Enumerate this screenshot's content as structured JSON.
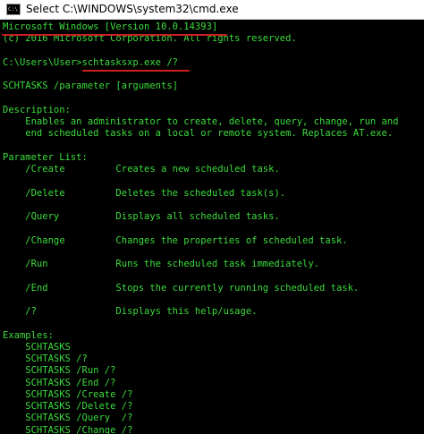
{
  "window": {
    "title": "Select C:\\WINDOWS\\system32\\cmd.exe",
    "icon": "cmd-icon",
    "icon_glyph": "C:\\"
  },
  "colors": {
    "text": "#3cdc3c",
    "background": "#000000",
    "annotation": "#cc1f1f"
  },
  "console": {
    "lines": [
      "Microsoft Windows [Version 10.0.14393]",
      "(c) 2016 Microsoft Corporation. All rights reserved.",
      "",
      "C:\\Users\\User>schtasksxp.exe /?",
      "",
      "SCHTASKS /parameter [arguments]",
      "",
      "Description:",
      "    Enables an administrator to create, delete, query, change, run and",
      "    end scheduled tasks on a local or remote system. Replaces AT.exe.",
      "",
      "Parameter List:",
      "    /Create         Creates a new scheduled task.",
      "",
      "    /Delete         Deletes the scheduled task(s).",
      "",
      "    /Query          Displays all scheduled tasks.",
      "",
      "    /Change         Changes the properties of scheduled task.",
      "",
      "    /Run            Runs the scheduled task immediately.",
      "",
      "    /End            Stops the currently running scheduled task.",
      "",
      "    /?              Displays this help/usage.",
      "",
      "Examples:",
      "    SCHTASKS",
      "    SCHTASKS /?",
      "    SCHTASKS /Run /?",
      "    SCHTASKS /End /?",
      "    SCHTASKS /Create /?",
      "    SCHTASKS /Delete /?",
      "    SCHTASKS /Query  /?",
      "    SCHTASKS /Change /?"
    ]
  }
}
